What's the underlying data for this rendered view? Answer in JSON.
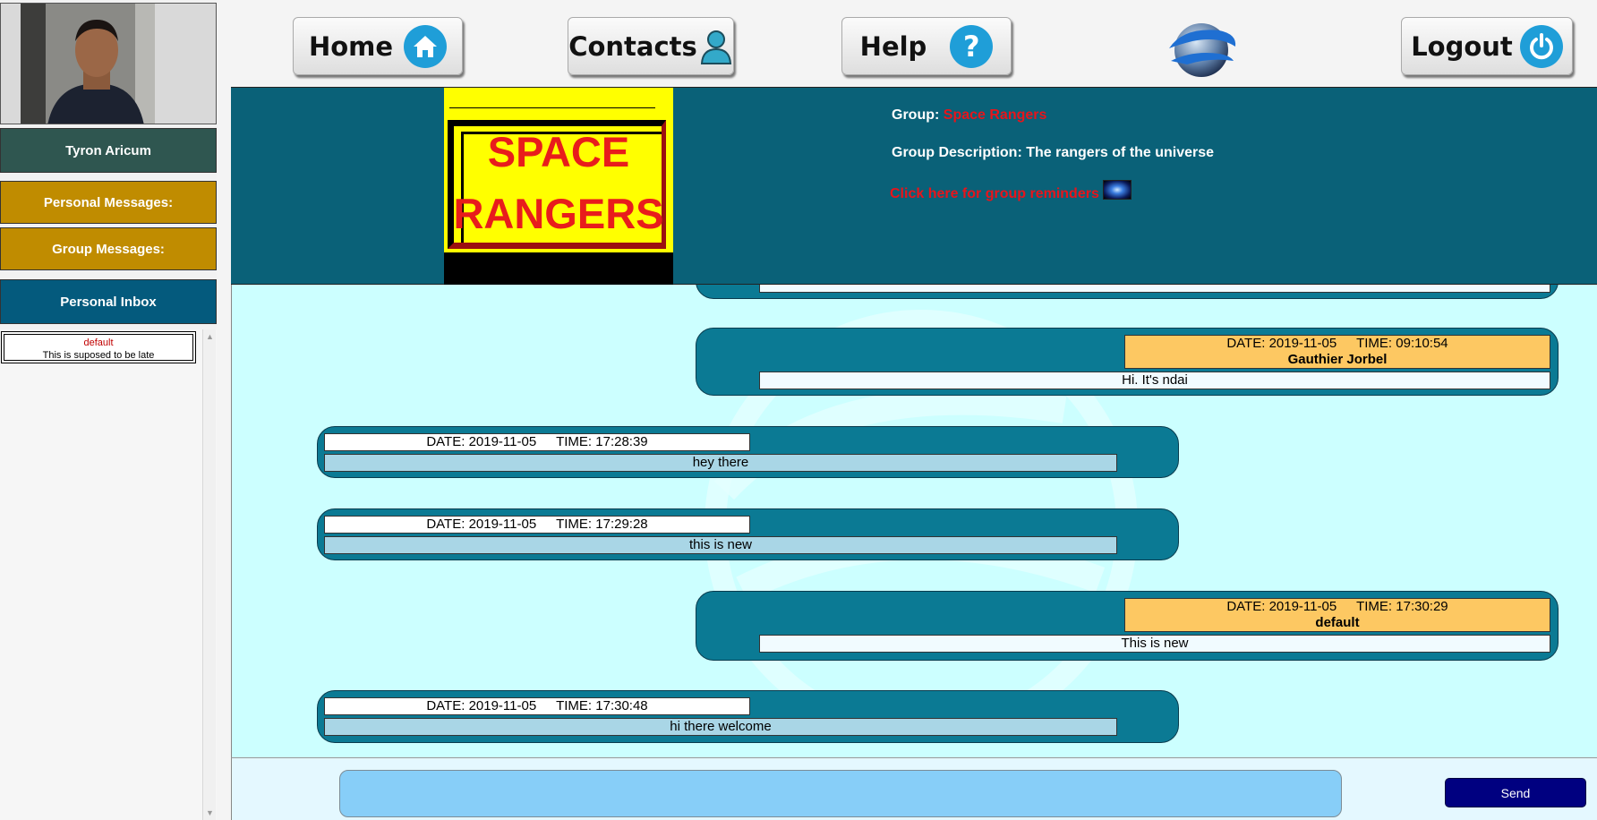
{
  "user": {
    "name": "Tyron Aricum",
    "avatar": "user-photo"
  },
  "sidebar": {
    "personal_messages_label": "Personal Messages:",
    "group_messages_label": "Group Messages:",
    "inbox_label": "Personal Inbox",
    "inbox_items": [
      {
        "sender": "default",
        "preview": "This is suposed to be late"
      }
    ]
  },
  "nav": {
    "home": {
      "label": "Home",
      "icon": "home-icon"
    },
    "contacts": {
      "label": "Contacts",
      "icon": "contact-icon"
    },
    "help": {
      "label": "Help",
      "icon": "question-icon"
    },
    "logout": {
      "label": "Logout",
      "icon": "power-icon"
    },
    "logo": "globe-logo"
  },
  "group": {
    "name_label": "Group:",
    "name": "Space Rangers",
    "description_label": "Group Description:",
    "description": "The rangers of the universe",
    "reminders_link": "Click here for group reminders",
    "logo_line1": "SPACE",
    "logo_line2": "RANGERS"
  },
  "messages": [
    {
      "side": "right",
      "date_label": "DATE:",
      "date": "2019-11-05",
      "time_label": "TIME:",
      "time": "09:10:54",
      "author": "Gauthier Jorbel",
      "text": "Hi. It's ndai"
    },
    {
      "side": "left",
      "date_label": "DATE:",
      "date": "2019-11-05",
      "time_label": "TIME:",
      "time": "17:28:39",
      "text": "hey there"
    },
    {
      "side": "left",
      "date_label": "DATE:",
      "date": "2019-11-05",
      "time_label": "TIME:",
      "time": "17:29:28",
      "text": "this is new"
    },
    {
      "side": "right",
      "date_label": "DATE:",
      "date": "2019-11-05",
      "time_label": "TIME:",
      "time": "17:30:29",
      "author": "default",
      "text": "This is new"
    },
    {
      "side": "left",
      "date_label": "DATE:",
      "date": "2019-11-05",
      "time_label": "TIME:",
      "time": "17:30:48",
      "text": "hi there welcome"
    }
  ],
  "composer": {
    "value": "",
    "send_label": "Send"
  },
  "colors": {
    "header_bg": "#0a6178",
    "chat_bg": "#ccffff",
    "bubble_bg": "#0b7a94",
    "author_meta_bg": "#fdc862",
    "sidebar_accent": "#c08c00",
    "send_bg": "#000080",
    "group_name": "#e8141b"
  }
}
